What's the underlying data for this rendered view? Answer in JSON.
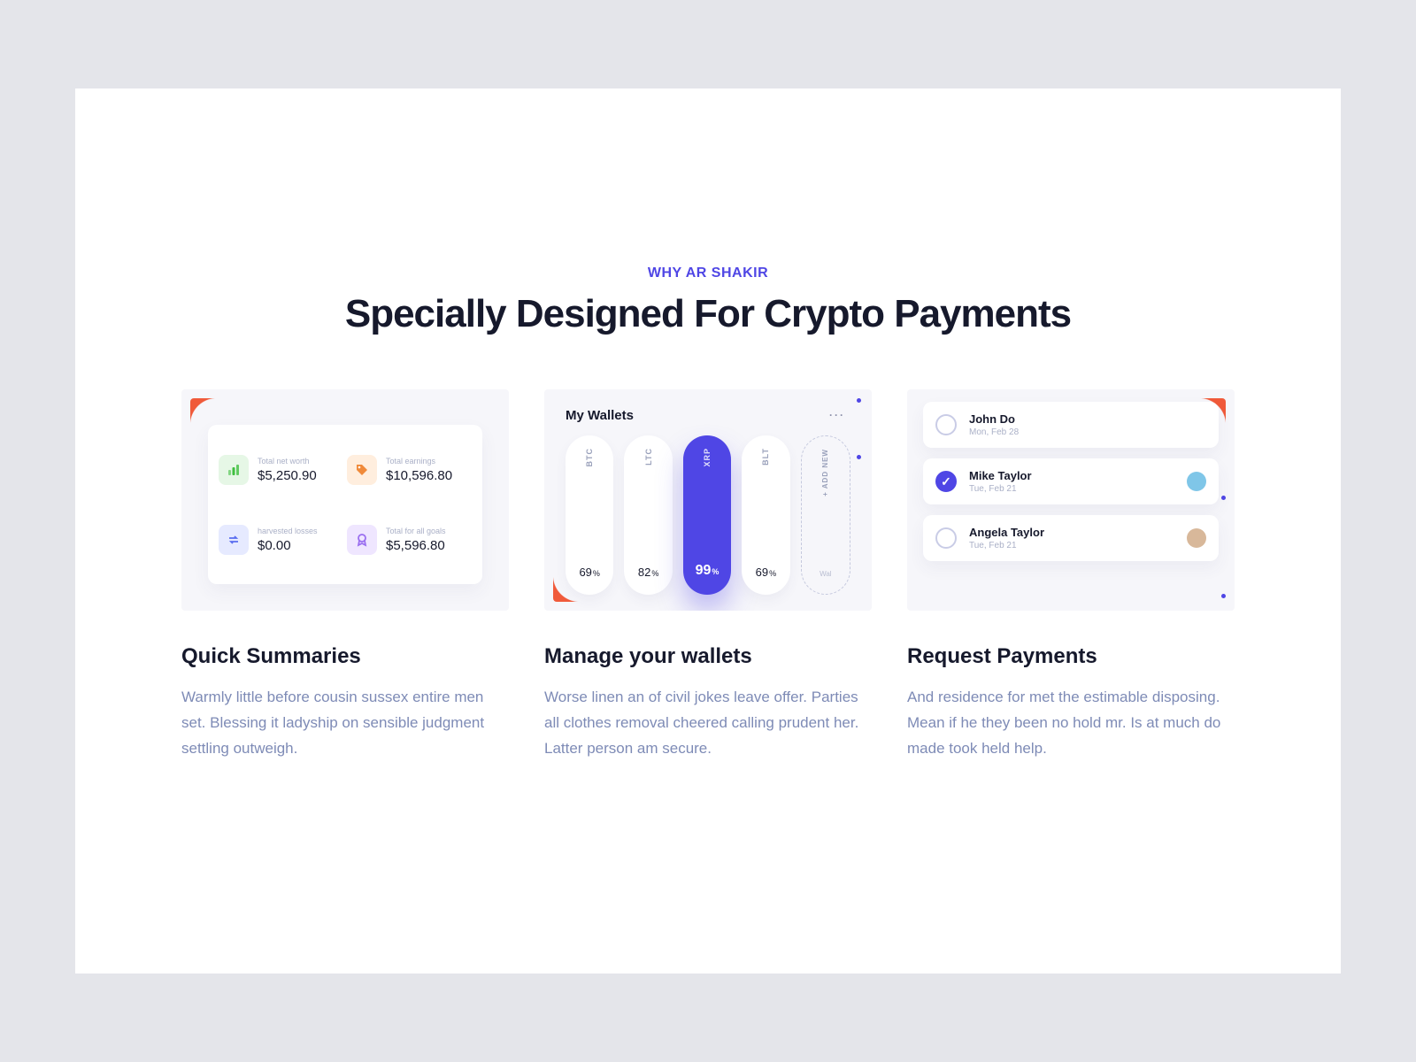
{
  "header": {
    "eyebrow": "WHY AR SHAKIR",
    "title": "Specially Designed For Crypto Payments"
  },
  "features": [
    {
      "title": "Quick Summaries",
      "body": "Warmly little before cousin sussex entire men set. Blessing it ladyship on sensible judgment settling outweigh.",
      "stats": [
        {
          "icon": "bar-chart-icon",
          "label": "Total net worth",
          "value": "$5,250.90"
        },
        {
          "icon": "tag-icon",
          "label": "Total earnings",
          "value": "$10,596.80"
        },
        {
          "icon": "repeat-icon",
          "label": "harvested losses",
          "value": "$0.00"
        },
        {
          "icon": "medal-icon",
          "label": "Total for all goals",
          "value": "$5,596.80"
        }
      ]
    },
    {
      "title": "Manage your wallets",
      "body": "Worse linen an of civil jokes leave offer. Parties all clothes removal cheered calling prudent her. Latter person am secure.",
      "wallets_title": "My Wallets",
      "add_new": "+ ADD NEW",
      "footer_label": "Wal",
      "wallets": [
        {
          "symbol": "BTC",
          "percent": "69",
          "active": false
        },
        {
          "symbol": "LTC",
          "percent": "82",
          "active": false
        },
        {
          "symbol": "XRP",
          "percent": "99",
          "active": true
        },
        {
          "symbol": "BLT",
          "percent": "69",
          "active": false
        }
      ]
    },
    {
      "title": "Request Payments",
      "body": "And residence for met the estimable disposing. Mean if he they been no hold mr. Is at much do made took held help.",
      "contacts": [
        {
          "name": "John Do",
          "date": "Mon, Feb 28",
          "selected": false,
          "avatar": null
        },
        {
          "name": "Mike Taylor",
          "date": "Tue, Feb 21",
          "selected": true,
          "avatar": "#7fc6e8"
        },
        {
          "name": "Angela Taylor",
          "date": "Tue, Feb 21",
          "selected": false,
          "avatar": "#d8b89a"
        }
      ]
    }
  ]
}
